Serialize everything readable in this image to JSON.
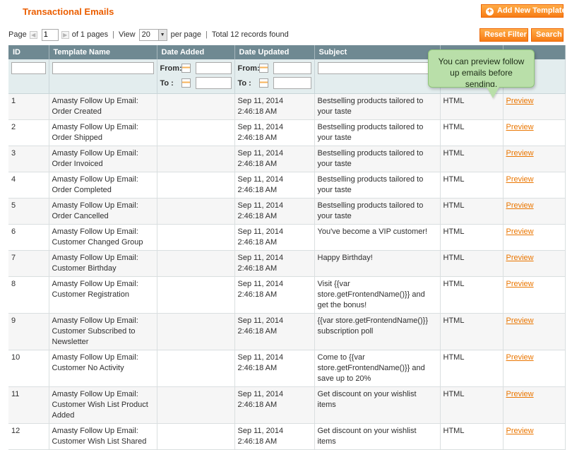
{
  "header": {
    "title": "Transactional Emails",
    "add_button": "Add New Template"
  },
  "pager": {
    "page_label": "Page",
    "page_value": "1",
    "of_pages": "of 1 pages",
    "view_label": "View",
    "view_value": "20",
    "per_page": "per page",
    "total": "Total 12 records found",
    "reset_button": "Reset Filter",
    "search_button": "Search"
  },
  "columns": [
    "ID",
    "Template Name",
    "Date Added",
    "Date Updated",
    "Subject",
    "",
    ""
  ],
  "filters": {
    "from_label": "From:",
    "to_label": "To :"
  },
  "tooltip": "You can preview follow up emails before sending.",
  "rows": [
    {
      "id": "1",
      "name": "Amasty Follow Up Email: Order Created",
      "added": "",
      "updated": "Sep 11, 2014 2:46:18 AM",
      "subject": "Bestselling products tailored to your taste",
      "type": "HTML",
      "action": "Preview"
    },
    {
      "id": "2",
      "name": "Amasty Follow Up Email: Order Shipped",
      "added": "",
      "updated": "Sep 11, 2014 2:46:18 AM",
      "subject": "Bestselling products tailored to your taste",
      "type": "HTML",
      "action": "Preview"
    },
    {
      "id": "3",
      "name": "Amasty Follow Up Email: Order Invoiced",
      "added": "",
      "updated": "Sep 11, 2014 2:46:18 AM",
      "subject": "Bestselling products tailored to your taste",
      "type": "HTML",
      "action": "Preview"
    },
    {
      "id": "4",
      "name": "Amasty Follow Up Email: Order Completed",
      "added": "",
      "updated": "Sep 11, 2014 2:46:18 AM",
      "subject": "Bestselling products tailored to your taste",
      "type": "HTML",
      "action": "Preview"
    },
    {
      "id": "5",
      "name": "Amasty Follow Up Email: Order Cancelled",
      "added": "",
      "updated": "Sep 11, 2014 2:46:18 AM",
      "subject": "Bestselling products tailored to your taste",
      "type": "HTML",
      "action": "Preview"
    },
    {
      "id": "6",
      "name": "Amasty Follow Up Email: Customer Changed Group",
      "added": "",
      "updated": "Sep 11, 2014 2:46:18 AM",
      "subject": "You've become a VIP customer!",
      "type": "HTML",
      "action": "Preview"
    },
    {
      "id": "7",
      "name": "Amasty Follow Up Email: Customer Birthday",
      "added": "",
      "updated": "Sep 11, 2014 2:46:18 AM",
      "subject": "Happy Birthday!",
      "type": "HTML",
      "action": "Preview"
    },
    {
      "id": "8",
      "name": "Amasty Follow Up Email: Customer Registration",
      "added": "",
      "updated": "Sep 11, 2014 2:46:18 AM",
      "subject": "Visit {{var store.getFrontendName()}} and get the bonus!",
      "type": "HTML",
      "action": "Preview"
    },
    {
      "id": "9",
      "name": "Amasty Follow Up Email: Customer Subscribed to Newsletter",
      "added": "",
      "updated": "Sep 11, 2014 2:46:18 AM",
      "subject": "{{var store.getFrontendName()}} subscription poll",
      "type": "HTML",
      "action": "Preview"
    },
    {
      "id": "10",
      "name": "Amasty Follow Up Email: Customer No Activity",
      "added": "",
      "updated": "Sep 11, 2014 2:46:18 AM",
      "subject": "Come to {{var store.getFrontendName()}} and save up to 20%",
      "type": "HTML",
      "action": "Preview"
    },
    {
      "id": "11",
      "name": "Amasty Follow Up Email: Customer Wish List Product Added",
      "added": "",
      "updated": "Sep 11, 2014 2:46:18 AM",
      "subject": "Get discount on your wishlist items",
      "type": "HTML",
      "action": "Preview"
    },
    {
      "id": "12",
      "name": "Amasty Follow Up Email: Customer Wish List Shared",
      "added": "",
      "updated": "Sep 11, 2014 2:46:18 AM",
      "subject": "Get discount on your wishlist items",
      "type": "HTML",
      "action": "Preview"
    }
  ],
  "colors": {
    "accent": "#eb5e00",
    "button": "#f77c16",
    "header_bg": "#6f8992",
    "filter_bg": "#e3edee",
    "tooltip_bg": "#b9dfa9",
    "link": "#ea7601"
  }
}
